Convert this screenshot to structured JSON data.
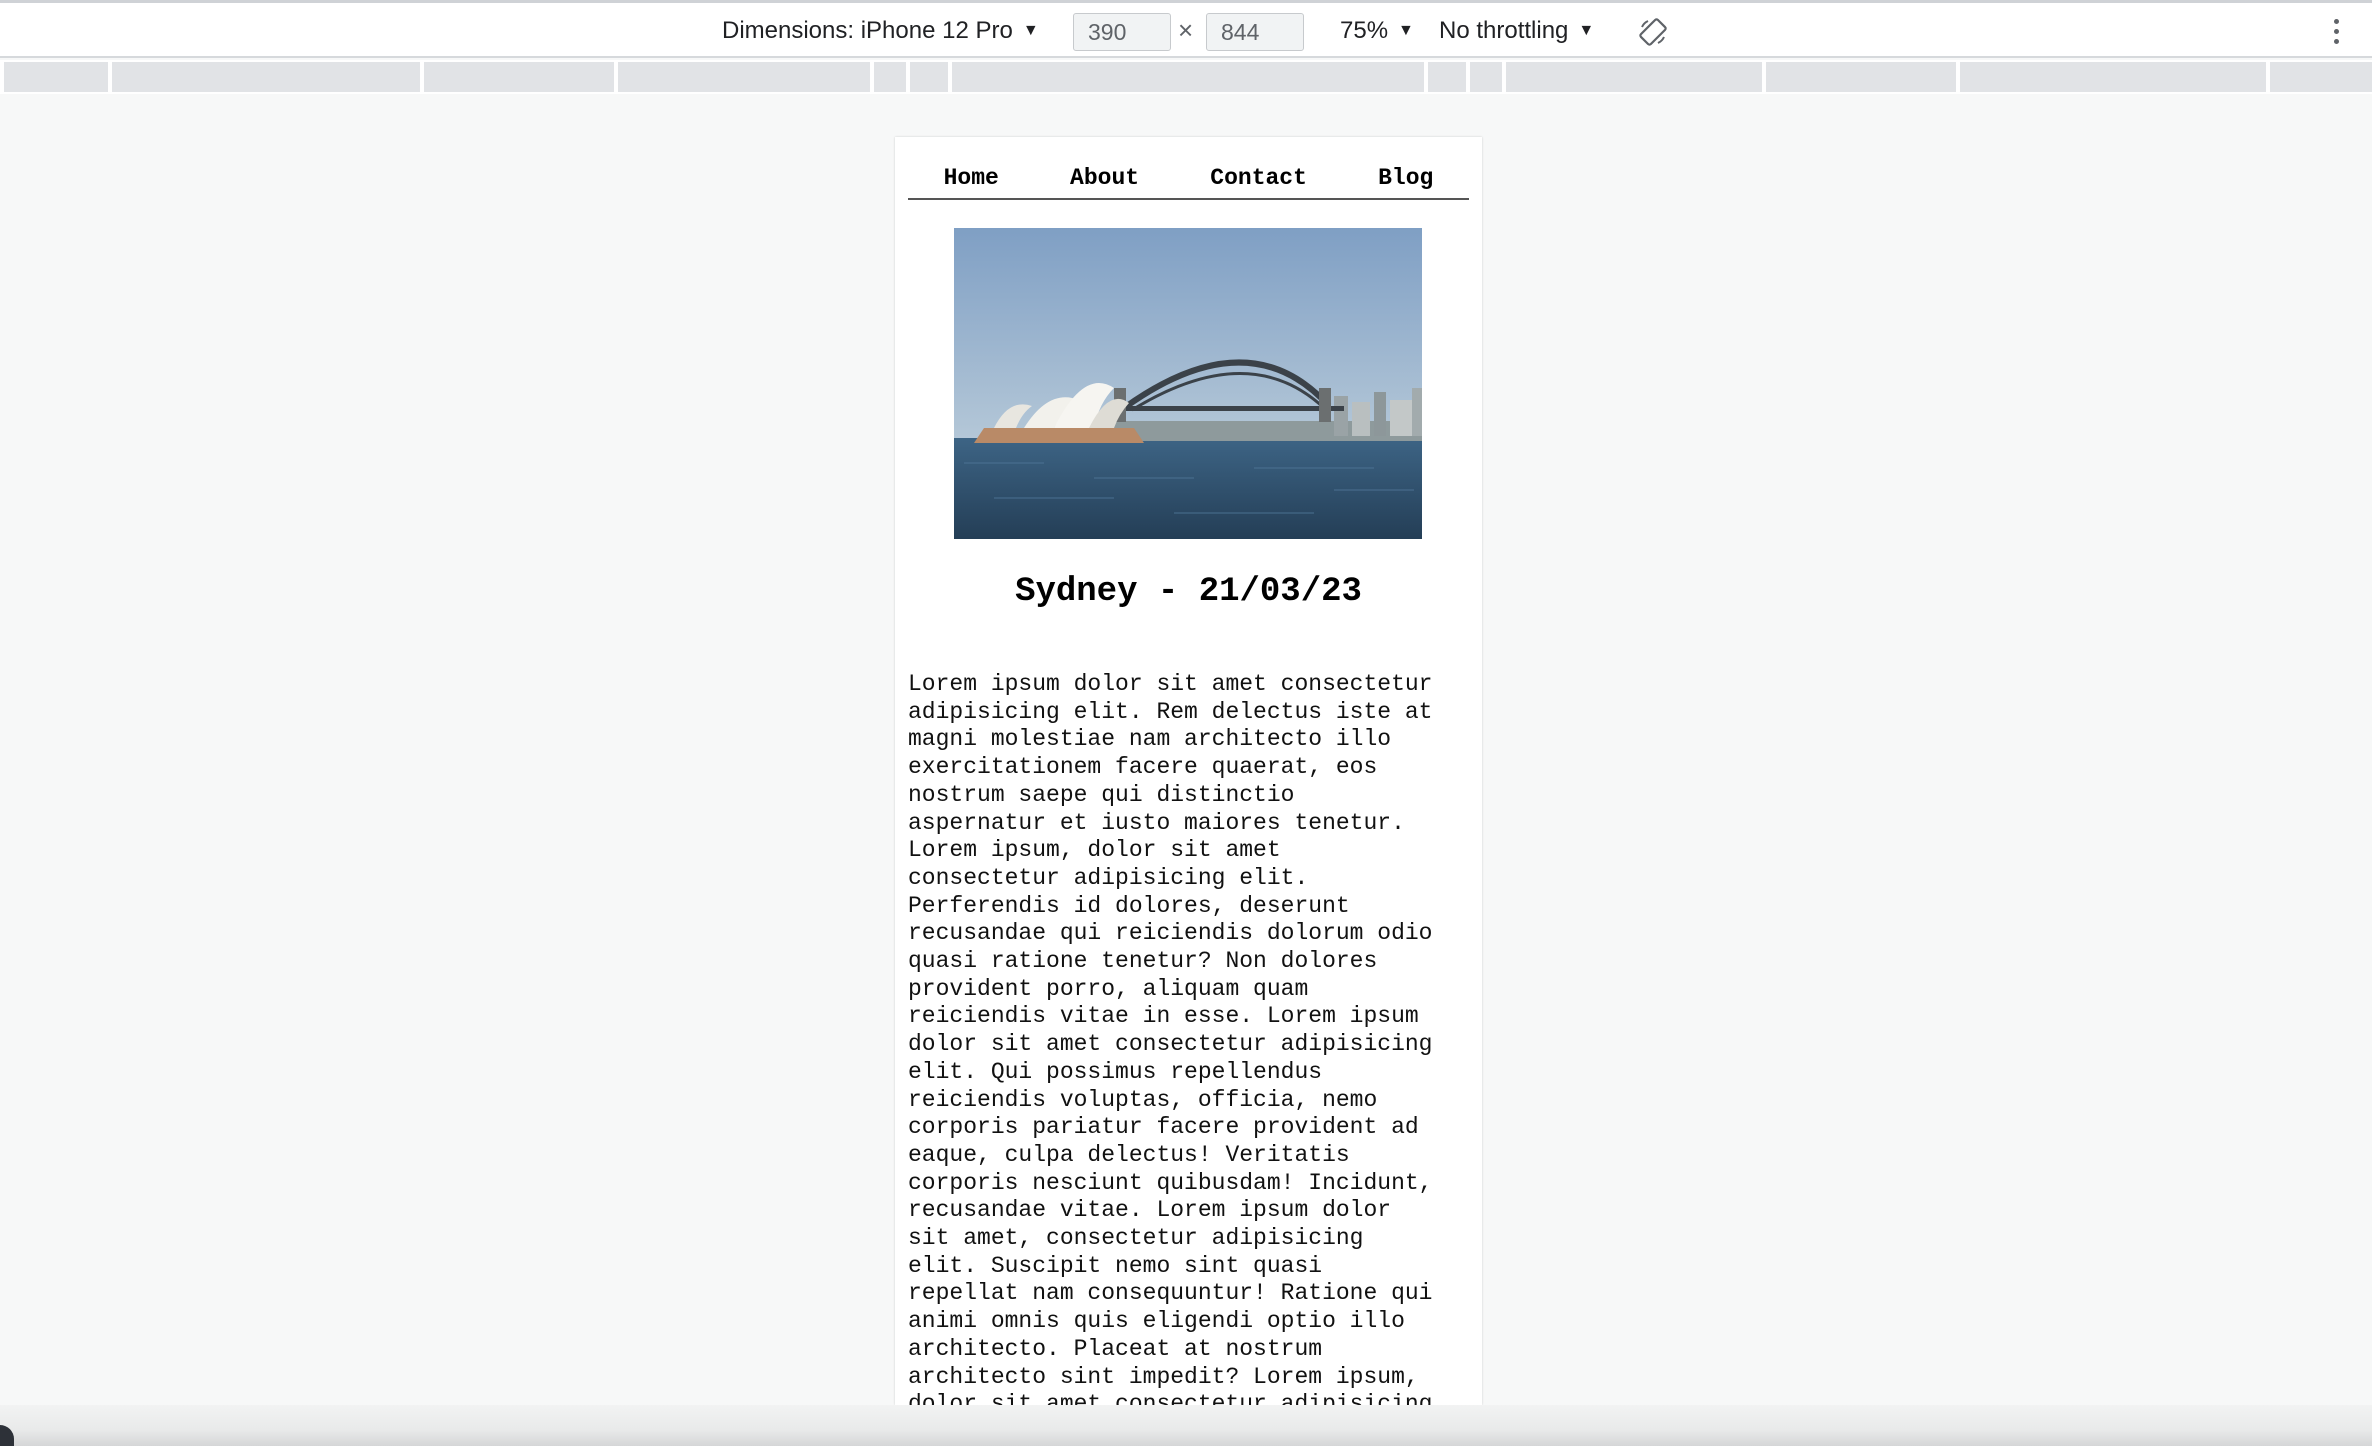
{
  "devtools": {
    "dimensions_label": "Dimensions: iPhone 12 Pro",
    "width_value": "390",
    "height_value": "844",
    "times": "×",
    "zoom": "75%",
    "throttling": "No throttling",
    "caret": "▼"
  },
  "nav": {
    "items": [
      {
        "label": "Home"
      },
      {
        "label": "About"
      },
      {
        "label": "Contact"
      },
      {
        "label": "Blog"
      }
    ]
  },
  "post": {
    "title": "Sydney - 21/03/23",
    "body": "Lorem ipsum dolor sit amet consectetur\nadipisicing elit. Rem delectus iste at\nmagni molestiae nam architecto illo\nexercitationem facere quaerat, eos\nnostrum saepe qui distinctio\naspernatur et iusto maiores tenetur.\nLorem ipsum, dolor sit amet\nconsectetur adipisicing elit.\nPerferendis id dolores, deserunt\nrecusandae qui reiciendis dolorum odio\nquasi ratione tenetur? Non dolores\nprovident porro, aliquam quam\nreiciendis vitae in esse. Lorem ipsum\ndolor sit amet consectetur adipisicing\nelit. Qui possimus repellendus\nreiciendis voluptas, officia, nemo\ncorporis pariatur facere provident ad\neaque, culpa delectus! Veritatis\ncorporis nesciunt quibusdam! Incidunt,\nrecusandae vitae. Lorem ipsum dolor\nsit amet, consectetur adipisicing\nelit. Suscipit nemo sint quasi\nrepellat nam consequuntur! Ratione qui\nanimi omnis quis eligendi optio illo\narchitecto. Placeat at nostrum\narchitecto sint impedit? Lorem ipsum,\ndolor sit amet consectetur adipisicing"
  },
  "colors": {
    "sky_top": "#7f9fc4",
    "sky_bottom": "#a9bfd4",
    "water": "#2f4e6a"
  }
}
